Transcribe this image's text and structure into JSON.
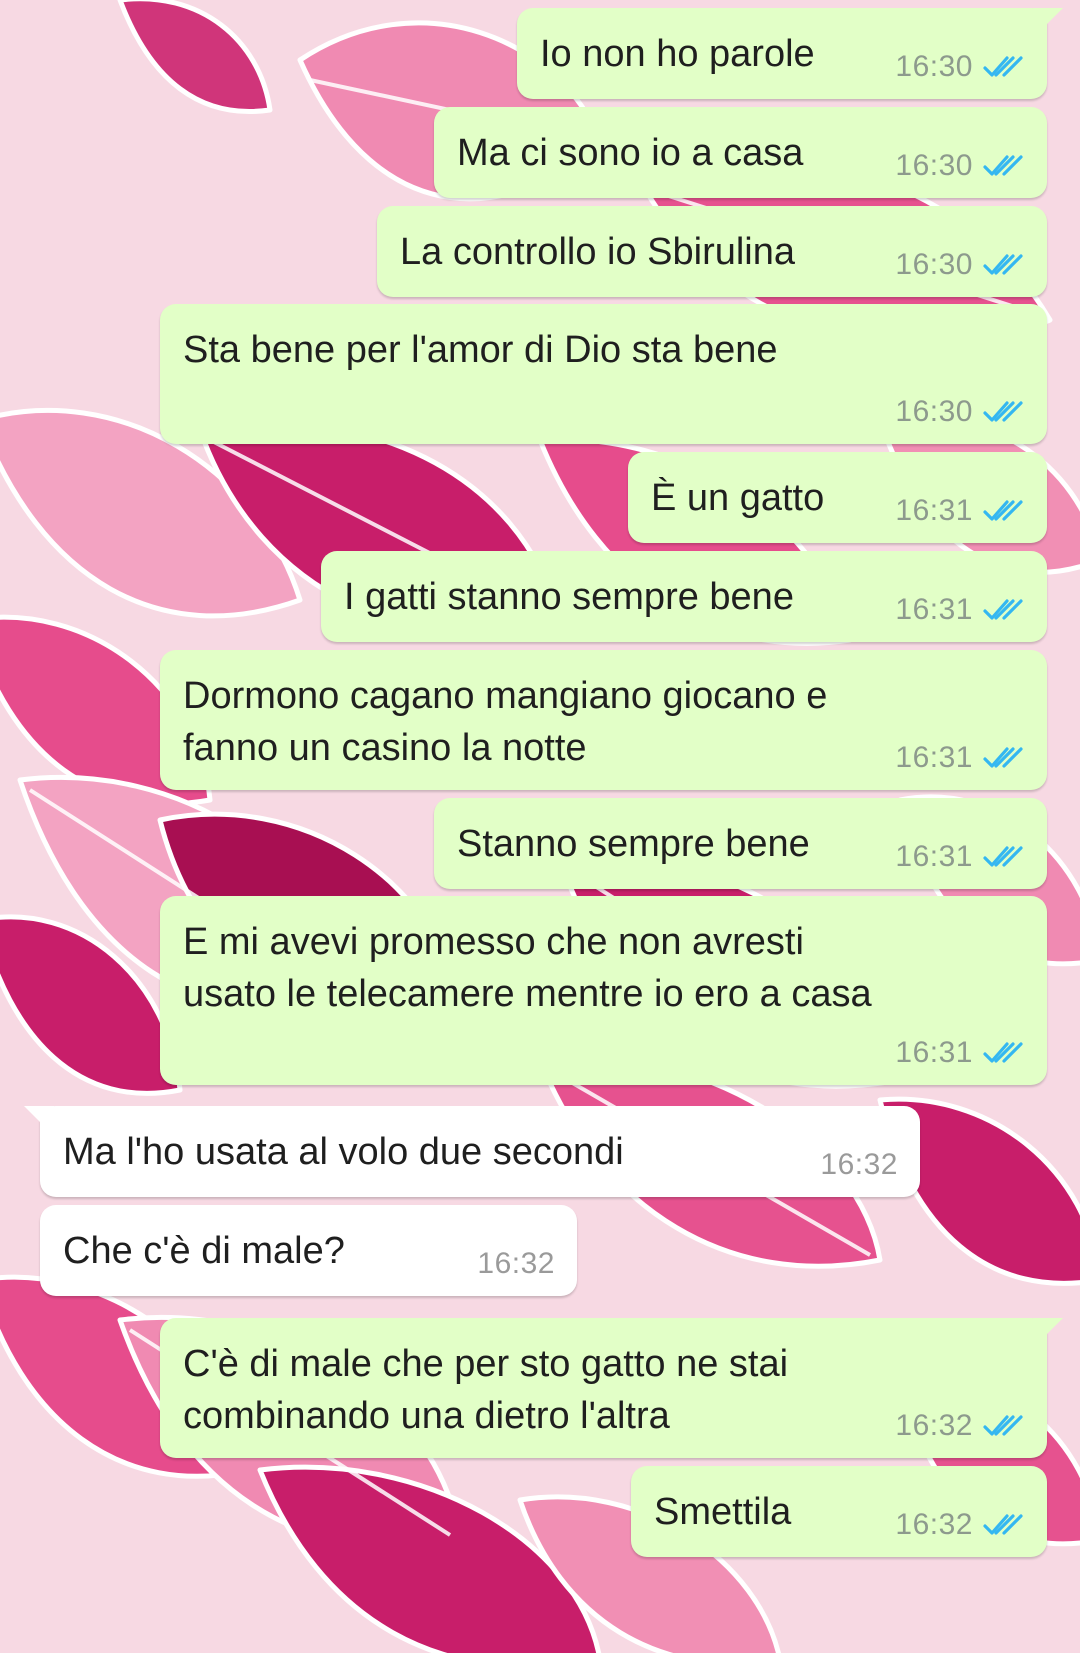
{
  "chat": {
    "messages": [
      {
        "direction": "out",
        "text": "Io non ho parole",
        "time": "16:30",
        "status": "read"
      },
      {
        "direction": "out",
        "text": "Ma ci sono io a casa",
        "time": "16:30",
        "status": "read"
      },
      {
        "direction": "out",
        "text": "La controllo io Sbirulina",
        "time": "16:30",
        "status": "read"
      },
      {
        "direction": "out",
        "text": "Sta bene per l'amor di Dio sta bene",
        "time": "16:30",
        "status": "read"
      },
      {
        "direction": "out",
        "text": "È un gatto",
        "time": "16:31",
        "status": "read"
      },
      {
        "direction": "out",
        "text": "I gatti stanno sempre bene",
        "time": "16:31",
        "status": "read"
      },
      {
        "direction": "out",
        "text": "Dormono cagano mangiano giocano e\nfanno un casino la notte",
        "time": "16:31",
        "status": "read"
      },
      {
        "direction": "out",
        "text": "Stanno sempre bene",
        "time": "16:31",
        "status": "read"
      },
      {
        "direction": "out",
        "text": "E mi avevi promesso che non avresti\nusato le telecamere mentre io ero a casa",
        "time": "16:31",
        "status": "read"
      },
      {
        "direction": "in",
        "text": "Ma l'ho usata al volo due secondi",
        "time": "16:32"
      },
      {
        "direction": "in",
        "text": "Che c'è di male?",
        "time": "16:32"
      },
      {
        "direction": "out",
        "text": "C'è di male che per sto gatto ne stai\ncombinando una dietro l'altra",
        "time": "16:32",
        "status": "read"
      },
      {
        "direction": "out",
        "text": "Smettila",
        "time": "16:32",
        "status": "read"
      }
    ]
  },
  "theme": {
    "outgoing_bubble": "#e2ffc7",
    "incoming_bubble": "#ffffff",
    "read_ticks": "#34b7f1",
    "wallpaper_base": "#f7d9e3",
    "wallpaper_leaf_colors": [
      "#e64c8c",
      "#c81e6a",
      "#f18fb4",
      "#a80f52"
    ]
  },
  "icons": {
    "read_status": "double-check-icon"
  }
}
